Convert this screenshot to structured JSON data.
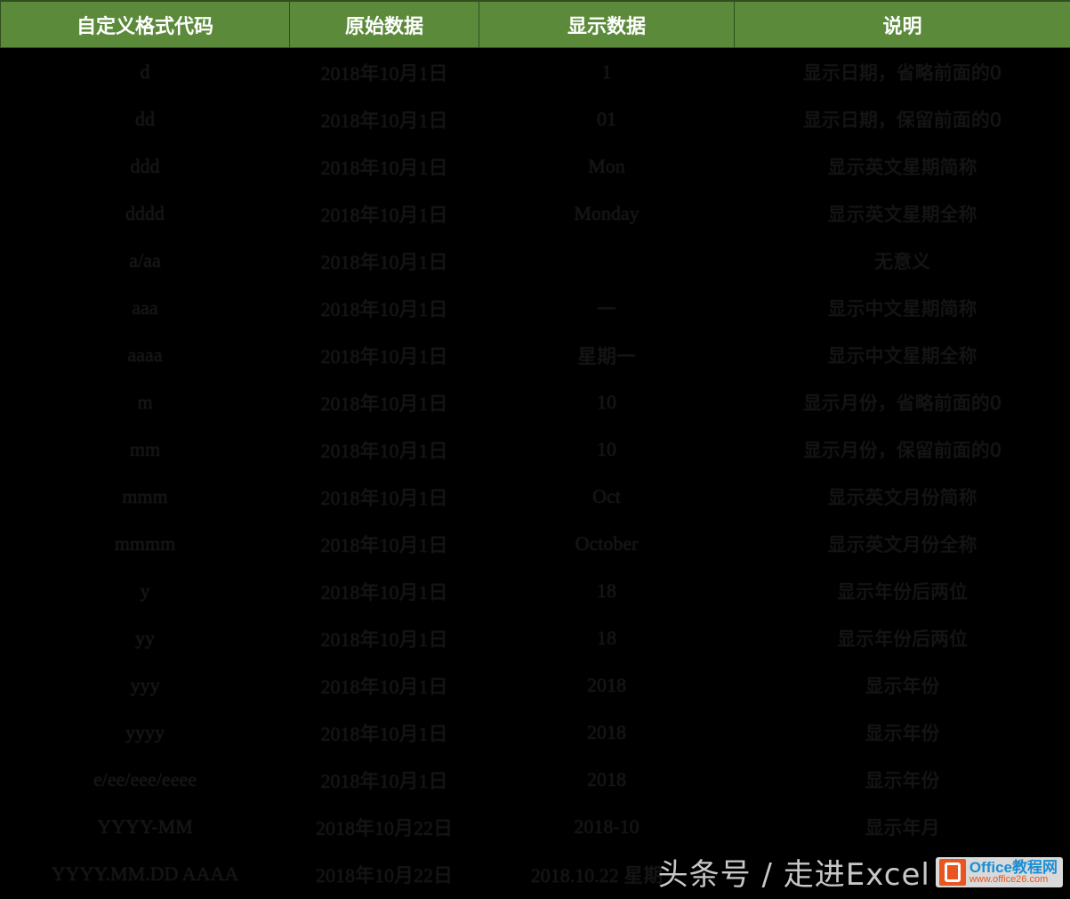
{
  "table": {
    "headers": [
      "自定义格式代码",
      "原始数据",
      "显示数据",
      "说明"
    ],
    "rows": [
      [
        "d",
        "2018年10月1日",
        "1",
        "显示日期，省略前面的0"
      ],
      [
        "dd",
        "2018年10月1日",
        "01",
        "显示日期，保留前面的0"
      ],
      [
        "ddd",
        "2018年10月1日",
        "Mon",
        "显示英文星期简称"
      ],
      [
        "dddd",
        "2018年10月1日",
        "Monday",
        "显示英文星期全称"
      ],
      [
        "a/aa",
        "2018年10月1日",
        "",
        "无意义"
      ],
      [
        "aaa",
        "2018年10月1日",
        "一",
        "显示中文星期简称"
      ],
      [
        "aaaa",
        "2018年10月1日",
        "星期一",
        "显示中文星期全称"
      ],
      [
        "m",
        "2018年10月1日",
        "10",
        "显示月份，省略前面的0"
      ],
      [
        "mm",
        "2018年10月1日",
        "10",
        "显示月份，保留前面的0"
      ],
      [
        "mmm",
        "2018年10月1日",
        "Oct",
        "显示英文月份简称"
      ],
      [
        "mmmm",
        "2018年10月1日",
        "October",
        "显示英文月份全称"
      ],
      [
        "y",
        "2018年10月1日",
        "18",
        "显示年份后两位"
      ],
      [
        "yy",
        "2018年10月1日",
        "18",
        "显示年份后两位"
      ],
      [
        "yyy",
        "2018年10月1日",
        "2018",
        "显示年份"
      ],
      [
        "yyyy",
        "2018年10月1日",
        "2018",
        "显示年份"
      ],
      [
        "e/ee/eee/eeee",
        "2018年10月1日",
        "2018",
        "显示年份"
      ],
      [
        "YYYY-MM",
        "2018年10月22日",
        "2018-10",
        "显示年月"
      ],
      [
        "YYYY.MM.DD AAAA",
        "2018年10月22日",
        "2018.10.22 星期一",
        ""
      ]
    ]
  },
  "watermark": {
    "text": "头条号 / 走进Excel",
    "brand": "Office教程网",
    "url": "www.office26.com"
  }
}
